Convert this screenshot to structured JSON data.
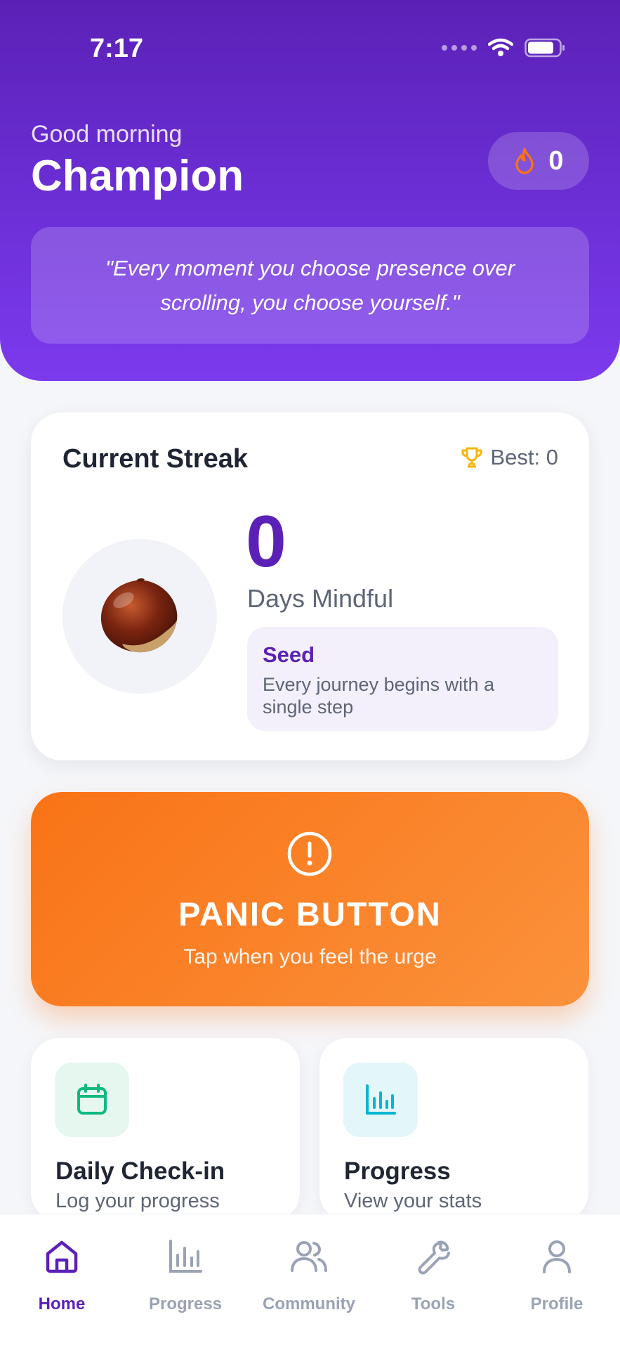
{
  "status_bar": {
    "time": "7:17"
  },
  "header": {
    "greeting": "Good morning",
    "name": "Champion",
    "streak_count": "0",
    "quote": "\"Every moment you choose presence over scrolling, you choose yourself.\""
  },
  "streak_card": {
    "title": "Current Streak",
    "best_label": "Best: 0",
    "days": "0",
    "days_label": "Days Mindful",
    "stage_name": "Seed",
    "stage_description": "Every journey begins with a single step"
  },
  "panic_button": {
    "title": "PANIC BUTTON",
    "subtitle": "Tap when you feel the urge"
  },
  "tiles": [
    {
      "title": "Daily Check-in",
      "subtitle": "Log your progress",
      "icon": "calendar-icon",
      "color": "#10b981"
    },
    {
      "title": "Progress",
      "subtitle": "View your stats",
      "icon": "bar-chart-icon",
      "color": "#06b6d4"
    }
  ],
  "tabs": [
    {
      "label": "Home",
      "icon": "home-icon",
      "active": true
    },
    {
      "label": "Progress",
      "icon": "bar-chart-icon",
      "active": false
    },
    {
      "label": "Community",
      "icon": "users-icon",
      "active": false
    },
    {
      "label": "Tools",
      "icon": "wrench-icon",
      "active": false
    },
    {
      "label": "Profile",
      "icon": "user-icon",
      "active": false
    }
  ],
  "colors": {
    "primary": "#5b21b6",
    "accent_orange": "#f97316",
    "background": "#f5f6f9"
  }
}
